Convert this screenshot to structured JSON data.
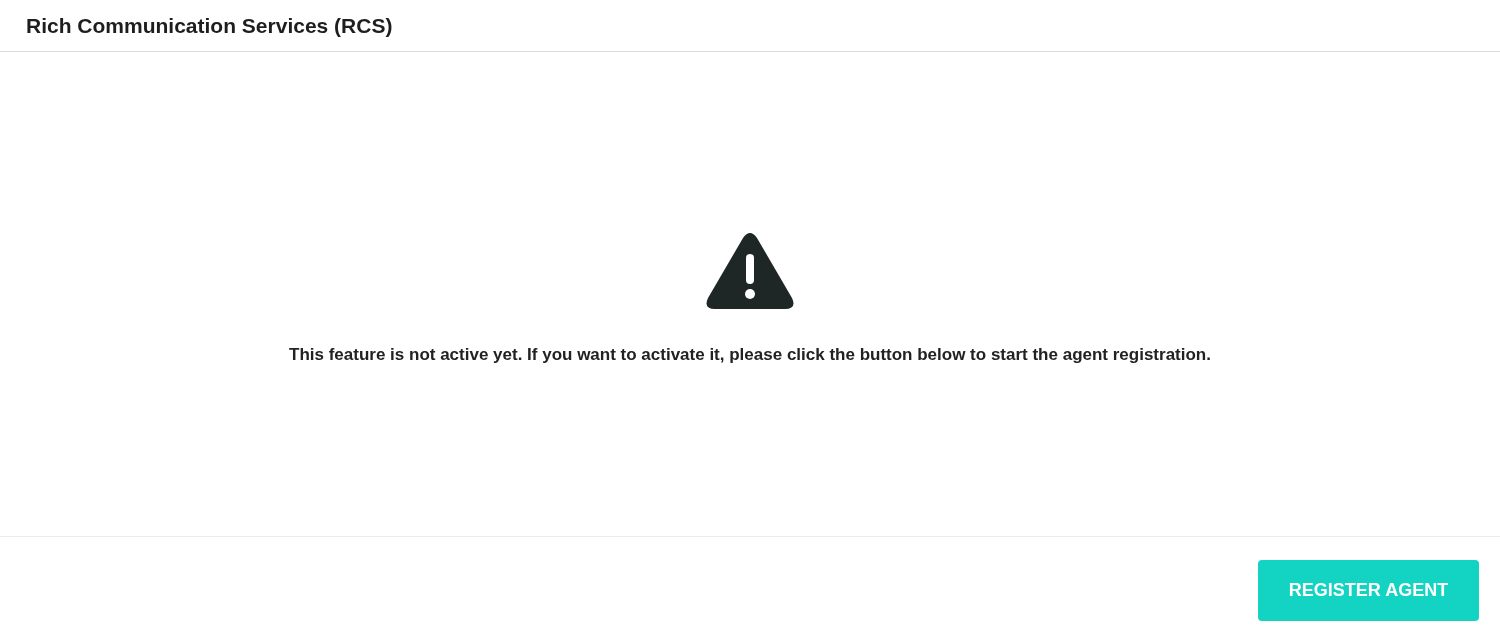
{
  "header": {
    "title": "Rich Communication Services (RCS)"
  },
  "notice": {
    "message": "This feature is not active yet. If you want to activate it, please click the button below to start the agent registration."
  },
  "footer": {
    "button": "REGISTER AGENT"
  }
}
